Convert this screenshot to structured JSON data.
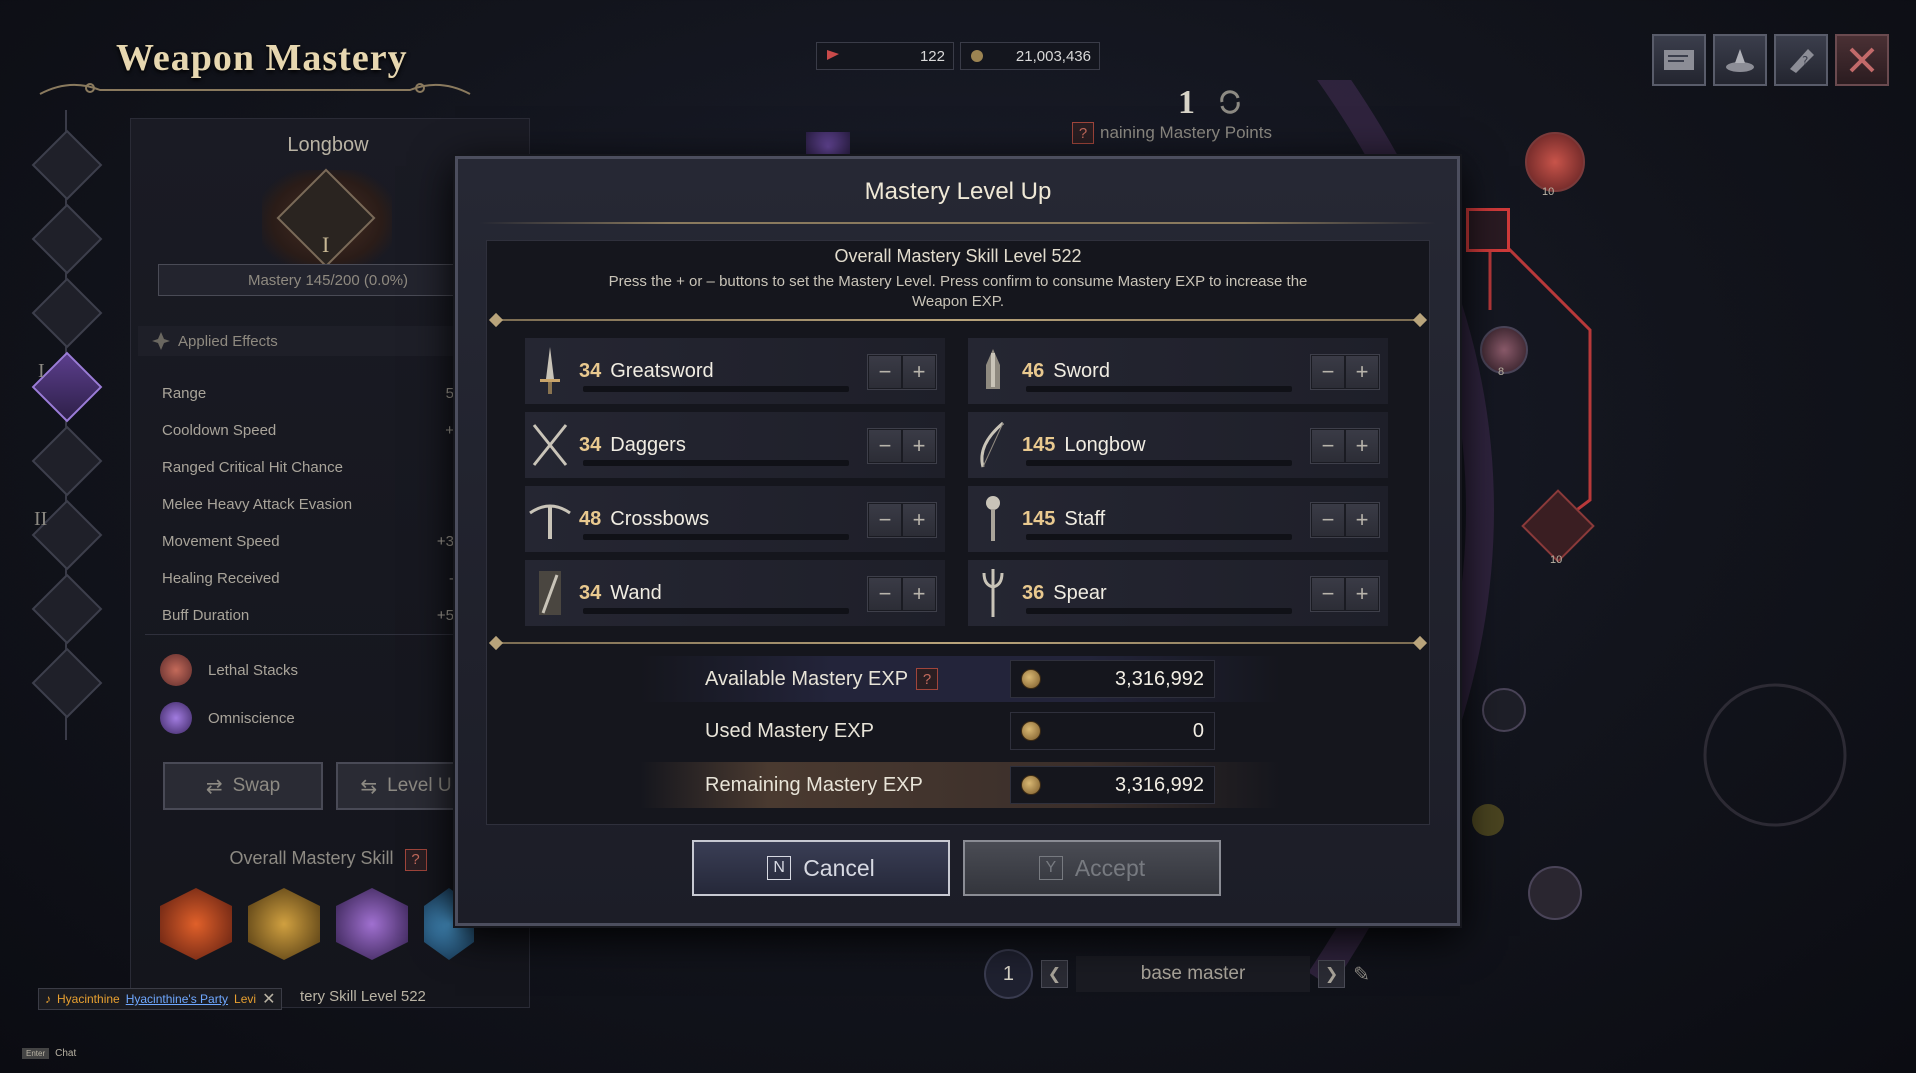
{
  "window": {
    "title": "Weapon Mastery",
    "currency_1": "122",
    "currency_2": "21,003,436"
  },
  "left_panel": {
    "weapon_name": "Longbow",
    "emblem_numeral": "I",
    "mastery_progress": "Mastery 145/200 (0.0%)",
    "applied_effects_label": "Applied Effects",
    "effects": [
      {
        "name": "Range",
        "value": "5"
      },
      {
        "name": "Cooldown Speed",
        "value": "+"
      },
      {
        "name": "Ranged Critical Hit Chance",
        "value": ""
      },
      {
        "name": "Melee Heavy Attack Evasion",
        "value": ""
      },
      {
        "name": "Movement Speed",
        "value": "+3"
      },
      {
        "name": "Healing Received",
        "value": "-"
      },
      {
        "name": "Buff Duration",
        "value": "+5"
      }
    ],
    "skills": [
      "Lethal Stacks",
      "Omniscience"
    ],
    "swap_label": "Swap",
    "level_label": "Level U",
    "overall_title": "Overall Mastery Skill",
    "overall_level": "tery Skill Level 522",
    "rail_numerals": [
      "I",
      "II"
    ]
  },
  "party_chip": {
    "name": "Hyacinthine",
    "link": "Hyacinthine's Party",
    "suffix": "Levi"
  },
  "chat_hint": {
    "key": "Enter",
    "label": "Chat"
  },
  "background": {
    "points_number": "1",
    "points_label": "naining Mastery Points",
    "node_counts": [
      "10",
      "8",
      "10"
    ],
    "preset_number": "1",
    "preset_name": "base master"
  },
  "modal": {
    "title": "Mastery Level Up",
    "overall_level": "Overall Mastery Skill Level 522",
    "description": "Press the + or – buttons to set the Mastery Level. Press confirm to consume Mastery EXP to increase the Weapon EXP.",
    "weapons": [
      {
        "level": "34",
        "name": "Greatsword",
        "icon": "greatsword-icon"
      },
      {
        "level": "46",
        "name": "Sword",
        "icon": "sword-icon"
      },
      {
        "level": "34",
        "name": "Daggers",
        "icon": "daggers-icon"
      },
      {
        "level": "145",
        "name": "Longbow",
        "icon": "longbow-icon"
      },
      {
        "level": "48",
        "name": "Crossbows",
        "icon": "crossbow-icon"
      },
      {
        "level": "145",
        "name": "Staff",
        "icon": "staff-icon"
      },
      {
        "level": "34",
        "name": "Wand",
        "icon": "wand-icon"
      },
      {
        "level": "36",
        "name": "Spear",
        "icon": "spear-icon"
      }
    ],
    "minus": "−",
    "plus": "+",
    "exp": {
      "available_label": "Available Mastery EXP",
      "available_value": "3,316,992",
      "used_label": "Used Mastery EXP",
      "used_value": "0",
      "remaining_label": "Remaining Mastery EXP",
      "remaining_value": "3,316,992",
      "help": "?"
    },
    "cancel_key": "N",
    "cancel_label": "Cancel",
    "accept_key": "Y",
    "accept_label": "Accept"
  },
  "colors": {
    "accent_gold": "#e9c98f",
    "accent_purple": "#9b7cd8",
    "danger_red": "#b8393a"
  }
}
